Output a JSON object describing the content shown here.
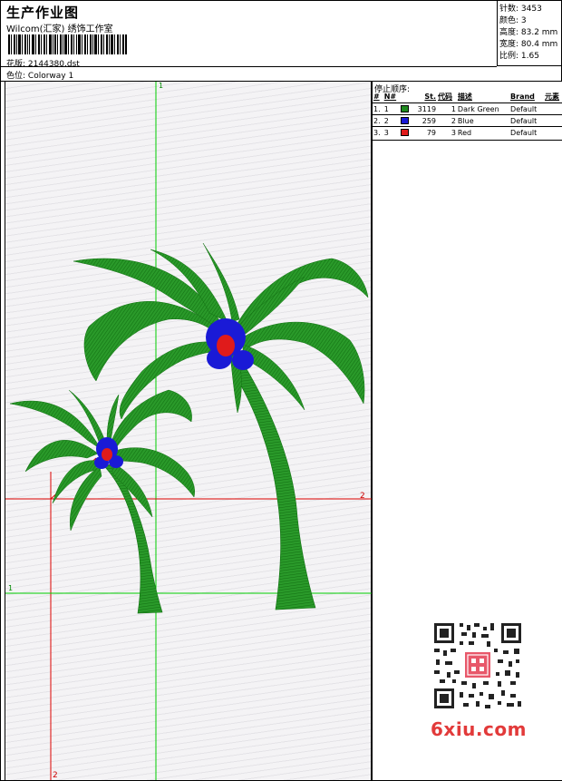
{
  "header": {
    "title": "生产作业图",
    "company": "Wilcom(汇家) 绣饰工作室",
    "design_label": "花版:",
    "design_value": "2144380.dst",
    "colorway_label": "色位:",
    "colorway_value": "Colorway 1"
  },
  "stats": {
    "stitches": "针数: 3453",
    "colors": "颜色: 3",
    "height": "高度: 83.2 mm",
    "width": "宽度: 80.4 mm",
    "scale": "比例: 1.65"
  },
  "panel": {
    "stop_title": "停止顺序:",
    "columns": [
      "#",
      "N#",
      "St.",
      "代码",
      "描述",
      "Brand",
      "元素"
    ],
    "rows": [
      {
        "idx": "1.",
        "n": "1",
        "color": "#1f8a1f",
        "st": "3119",
        "code": "1",
        "desc": "Dark Green",
        "brand": "Default"
      },
      {
        "idx": "2.",
        "n": "2",
        "color": "#1a1ad6",
        "st": "259",
        "code": "2",
        "desc": "Blue",
        "brand": "Default"
      },
      {
        "idx": "3.",
        "n": "3",
        "color": "#e01b1b",
        "st": "79",
        "code": "3",
        "desc": "Red",
        "brand": "Default"
      }
    ]
  },
  "guides": {
    "v1_label": "1",
    "h1_label": "1",
    "h2_label": "2",
    "v2_label": "2"
  },
  "watermark": "6xiu.com",
  "colors": {
    "leaf_green": "#1f8a1f",
    "coconut_blue": "#1a1ad6",
    "coconut_red": "#e01b1b",
    "guide_green": "#00cc00",
    "guide_red": "#dd0000"
  }
}
